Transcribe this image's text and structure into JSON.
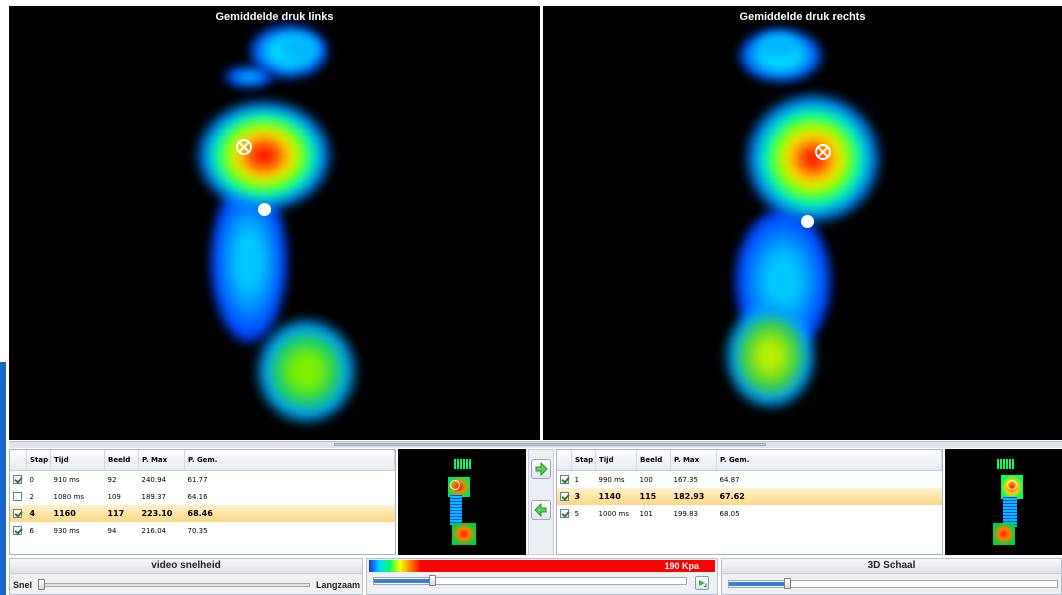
{
  "views": {
    "left_title": "Gemiddelde druk links",
    "right_title": "Gemiddelde druk rechts"
  },
  "table_headers": [
    "Stap",
    "Tijd",
    "Beeld",
    "P. Max",
    "P. Gem."
  ],
  "left_table": [
    {
      "checked": true,
      "selected": false,
      "stap": "0",
      "tijd": "910 ms",
      "beeld": "92",
      "pmax": "240.94",
      "pgem": "61.77"
    },
    {
      "checked": false,
      "selected": false,
      "stap": "2",
      "tijd": "1080 ms",
      "beeld": "109",
      "pmax": "189.37",
      "pgem": "64.16"
    },
    {
      "checked": true,
      "selected": true,
      "stap": "4",
      "tijd": "1160",
      "beeld": "117",
      "pmax": "223.10",
      "pgem": "68.46"
    },
    {
      "checked": true,
      "selected": false,
      "stap": "6",
      "tijd": "930 ms",
      "beeld": "94",
      "pmax": "216.04",
      "pgem": "70.35"
    }
  ],
  "right_table": [
    {
      "checked": true,
      "selected": false,
      "stap": "1",
      "tijd": "990 ms",
      "beeld": "100",
      "pmax": "167.35",
      "pgem": "64.87"
    },
    {
      "checked": true,
      "selected": true,
      "stap": "3",
      "tijd": "1140",
      "beeld": "115",
      "pmax": "182.93",
      "pgem": "67.62"
    },
    {
      "checked": true,
      "selected": false,
      "stap": "5",
      "tijd": "1000 ms",
      "beeld": "101",
      "pmax": "199.83",
      "pgem": "68.05"
    }
  ],
  "nav": {
    "forward_icon": "arrow-right-icon",
    "back_icon": "arrow-left-icon"
  },
  "video_panel": {
    "title": "video snelheid",
    "left_label": "Snel",
    "right_label": "Langzaam",
    "slider_level": 0.0
  },
  "scale_panel": {
    "max_label": "190 Kpa",
    "slider_level": 0.18,
    "refresh_icon": "refresh-icon"
  },
  "schaal_panel": {
    "title": "3D Schaal",
    "slider_level": 0.17
  },
  "colors": {
    "selected_row": "#fbd885",
    "pressure_max": "#ff0000",
    "background": "#000000"
  }
}
